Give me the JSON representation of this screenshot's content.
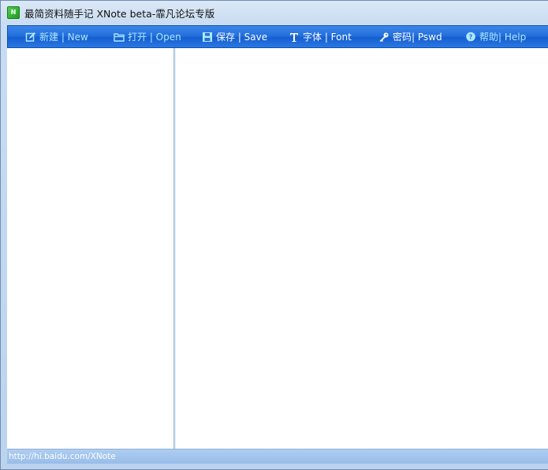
{
  "window": {
    "title": "最简资料随手记 XNote beta-霏凡论坛专版",
    "icon": "app-icon"
  },
  "toolbar": {
    "new_label": "新建 | New",
    "open_label": "打开 | Open",
    "save_label": "保存 | Save",
    "font_label": "字体 | Font",
    "password_label": "密码| Pswd",
    "help_label": "帮助| Help",
    "icons": [
      "edit-icon",
      "folder-icon",
      "floppy-icon",
      "font-icon",
      "key-icon",
      "help-icon"
    ]
  },
  "statusbar": {
    "text": "http://hi.baidu.com/XNote"
  },
  "colors": {
    "toolbar_blue": "#2470dc",
    "label_light": "#aee8ff",
    "label_white": "#ffffff",
    "status_blue": "#a6c7ee"
  }
}
